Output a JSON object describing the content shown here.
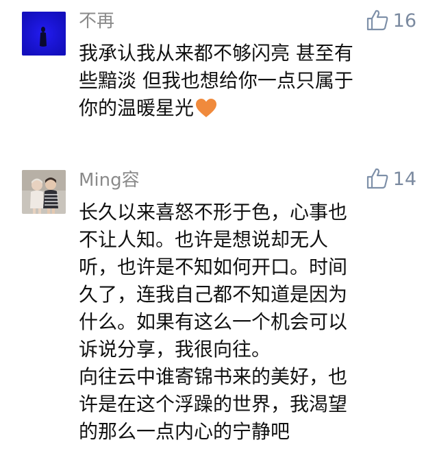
{
  "comments": [
    {
      "user": "不再",
      "likes": "16",
      "avatar_icon": "dark-blue-silhouette-avatar",
      "lines": [
        "我承认我从来都不够闪亮  甚至有",
        "些黯淡  但我也想给你一点只属于",
        "你的温暖星光"
      ],
      "trailing_emoji": "orange-heart-icon"
    },
    {
      "user": "Ming容",
      "likes": "14",
      "avatar_icon": "two-children-photo-avatar",
      "lines": [
        "长久以来喜怒不形于色，心事也",
        "不让人知。也许是想说却无人",
        "听，也许是不知如何开口。时间",
        "久了，连我自己都不知道是因为",
        "什么。如果有这么一个机会可以",
        "诉说分享，我很向往。",
        "向往云中谁寄锦书来的美好，也",
        "许是在这个浮躁的世界，我渴望",
        "的那么一点内心的宁静吧"
      ]
    }
  ],
  "colors": {
    "username": "#8a8a8a",
    "like": "#7b8aa0",
    "text": "#111111",
    "heart": "#f08a3c"
  }
}
